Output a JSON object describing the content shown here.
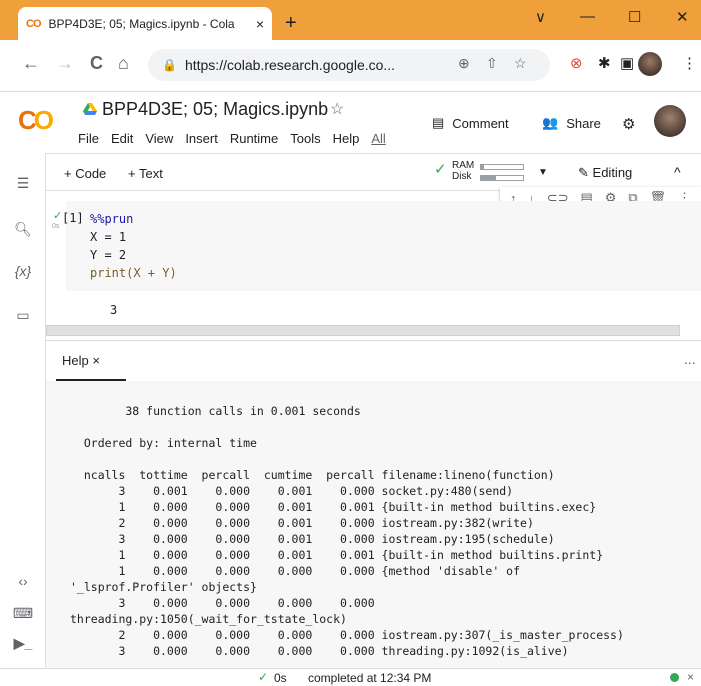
{
  "browser": {
    "tab_title": "BPP4D3E; 05; Magics.ipynb - Cola",
    "tab_close": "×",
    "new_tab": "+",
    "url": "https://colab.research.google.co...",
    "nav": {
      "back": "←",
      "forward": "→",
      "reload": "C",
      "home": "⌂"
    },
    "window": {
      "chevron": "∨",
      "minimize": "—",
      "maximize": "☐",
      "close": "✕"
    }
  },
  "colab": {
    "logo_left": "C",
    "logo_right": "O",
    "notebook_title": "BPP4D3E; 05; Magics.ipynb",
    "star": "☆",
    "menus": [
      "File",
      "Edit",
      "View",
      "Insert",
      "Runtime",
      "Tools",
      "Help",
      "All"
    ],
    "comment_label": "Comment",
    "share_label": "Share"
  },
  "toolbar": {
    "add_code": "+ Code",
    "add_text": "+ Text",
    "ram_label": "RAM",
    "disk_label": "Disk",
    "ram_fraction": 0.08,
    "disk_fraction": 0.35,
    "editing_label": "Editing",
    "collapse": "^"
  },
  "cell": {
    "exec_count": "[1]",
    "run_time": "0s",
    "code_lines": [
      "%%prun",
      "X = 1",
      "Y = 2",
      "print(X + Y)"
    ],
    "output": "3"
  },
  "help": {
    "tab_label": "Help ×",
    "more": "...",
    "profile_lines": [
      "        38 function calls in 0.001 seconds",
      "",
      "  Ordered by: internal time",
      "",
      "  ncalls  tottime  percall  cumtime  percall filename:lineno(function)",
      "       3    0.001    0.000    0.001    0.000 socket.py:480(send)",
      "       1    0.000    0.000    0.001    0.001 {built-in method builtins.exec}",
      "       2    0.000    0.000    0.001    0.000 iostream.py:382(write)",
      "       3    0.000    0.000    0.001    0.000 iostream.py:195(schedule)",
      "       1    0.000    0.000    0.001    0.001 {built-in method builtins.print}",
      "       1    0.000    0.000    0.000    0.000 {method 'disable' of",
      "'_lsprof.Profiler' objects}",
      "       3    0.000    0.000    0.000    0.000",
      "threading.py:1050(_wait_for_tstate_lock)",
      "       2    0.000    0.000    0.000    0.000 iostream.py:307(_is_master_process)",
      "       3    0.000    0.000    0.000    0.000 threading.py:1092(is_alive)"
    ]
  },
  "status": {
    "check": "✓",
    "time": "0s",
    "message": "completed at 12:34 PM",
    "close": "×"
  },
  "colors": {
    "tabstrip": "#f0a03a",
    "accent_green": "#34a853",
    "colab_orange": "#e8710a",
    "colab_yellow": "#f9ab00"
  }
}
